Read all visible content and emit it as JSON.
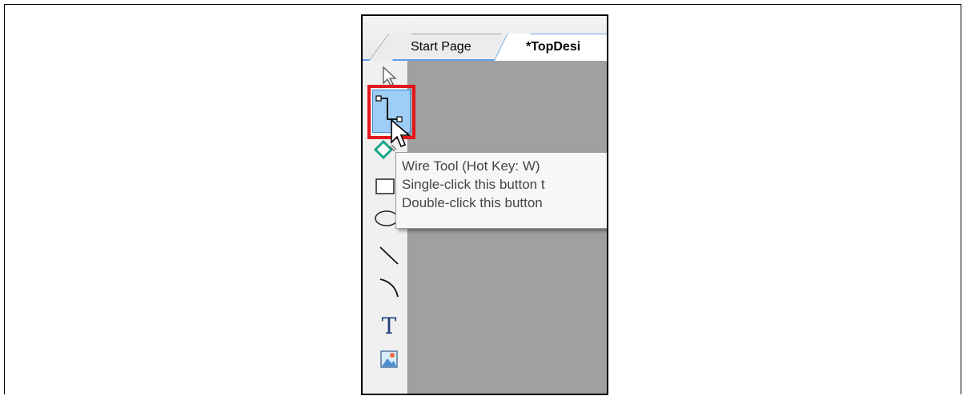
{
  "tabs": {
    "start_page": "Start Page",
    "top_design": "*TopDesi"
  },
  "toolbar": {
    "tools": [
      {
        "name": "select-arrow-icon"
      },
      {
        "name": "wire-tool-icon"
      },
      {
        "name": "diamond-shape-icon"
      },
      {
        "name": "rectangle-icon"
      },
      {
        "name": "ellipse-icon"
      },
      {
        "name": "line-icon"
      },
      {
        "name": "arc-icon"
      },
      {
        "name": "text-tool-icon",
        "glyph": "T"
      },
      {
        "name": "image-icon"
      }
    ]
  },
  "tooltip": {
    "line1": "Wire Tool (Hot Key: W)",
    "line2": "Single-click this button t",
    "line3": "Double-click this button"
  },
  "colors": {
    "highlight": "#e3161c",
    "active_button": "#9ecdf5",
    "canvas": "#a0a0a0",
    "tab_accent": "#5aa0e6"
  }
}
